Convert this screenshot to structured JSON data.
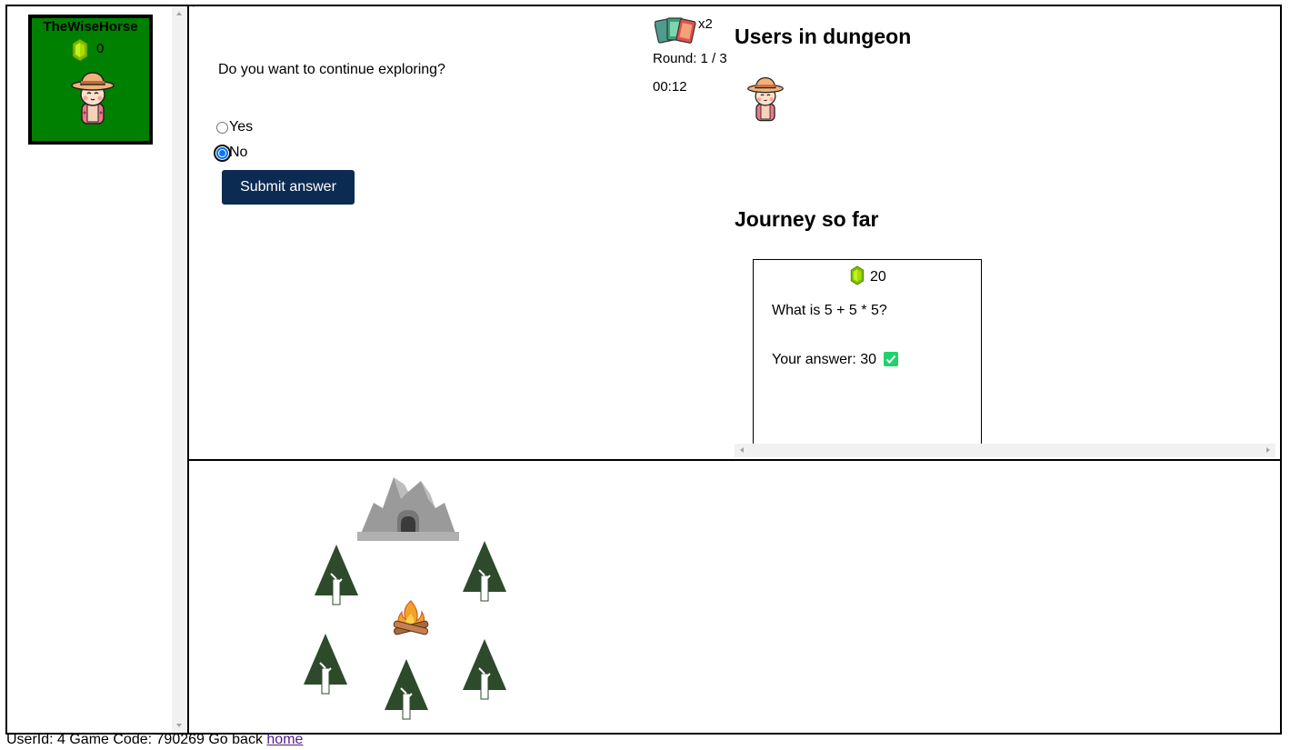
{
  "sidebar": {
    "player": {
      "name": "TheWiseHorse",
      "gems": "0",
      "card_color": "#008000"
    }
  },
  "quiz": {
    "stray_char": "`",
    "question": "Do you want to continue exploring?",
    "options": [
      {
        "label": "Yes",
        "selected": false
      },
      {
        "label": "No",
        "selected": true
      }
    ],
    "submit_label": "Submit answer",
    "submit_color": "#0c2b52"
  },
  "status": {
    "cards_multiplier": "x2",
    "round": "Round: 1 / 3",
    "timer": "00:12"
  },
  "users": {
    "title": "Users in dungeon"
  },
  "journey": {
    "title": "Journey so far",
    "cards": [
      {
        "gems": "20",
        "question": "What is 5 + 5 * 5?",
        "answer": "Your answer: 30",
        "correct": true
      }
    ]
  },
  "map": {
    "items": [
      "cave-icon",
      "tree-icon",
      "tree-icon",
      "campfire-icon",
      "tree-icon",
      "tree-icon",
      "tree-icon"
    ]
  },
  "footer": {
    "text": "UserId: 4 Game Code: 790269 Go back",
    "link_label": "home"
  }
}
